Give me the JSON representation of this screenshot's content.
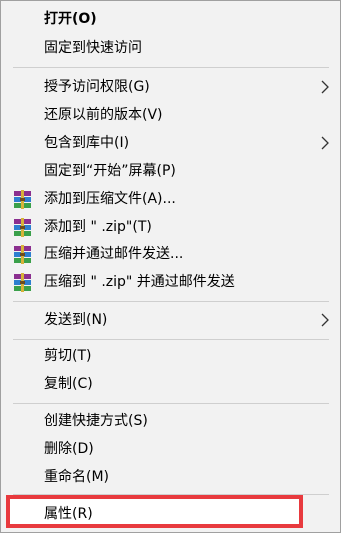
{
  "menu": {
    "items": [
      {
        "id": "open",
        "label": "打开(O)"
      },
      {
        "id": "pin-quick-access",
        "label": "固定到快速访问"
      },
      {
        "id": "grant-access",
        "label": "授予访问权限(G)"
      },
      {
        "id": "restore-previous",
        "label": "还原以前的版本(V)"
      },
      {
        "id": "include-in-library",
        "label": "包含到库中(I)"
      },
      {
        "id": "pin-start",
        "label": "固定到“开始”屏幕(P)"
      },
      {
        "id": "add-to-archive",
        "label": "添加到压缩文件(A)..."
      },
      {
        "id": "add-to-zip",
        "label": "添加到 \" .zip\"(T)"
      },
      {
        "id": "compress-email",
        "label": "压缩并通过邮件发送..."
      },
      {
        "id": "compress-zip-email",
        "label": "压缩到 \" .zip\" 并通过邮件发送"
      },
      {
        "id": "send-to",
        "label": "发送到(N)"
      },
      {
        "id": "cut",
        "label": "剪切(T)"
      },
      {
        "id": "copy",
        "label": "复制(C)"
      },
      {
        "id": "create-shortcut",
        "label": "创建快捷方式(S)"
      },
      {
        "id": "delete",
        "label": "删除(D)"
      },
      {
        "id": "rename",
        "label": "重命名(M)"
      },
      {
        "id": "properties",
        "label": "属性(R)"
      }
    ]
  },
  "icons": {
    "submenu": "chevron-right-icon",
    "archive": "winrar-archive-icon"
  },
  "colors": {
    "menu_background": "#f2f2f2",
    "separator": "#cfcfcf",
    "highlight_border": "#e83a3e",
    "highlight_fill": "#ffffff"
  }
}
